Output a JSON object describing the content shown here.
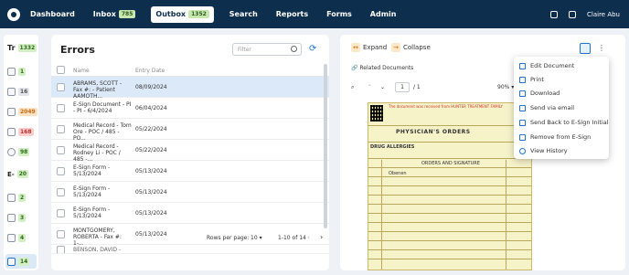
{
  "nav": {
    "items": [
      {
        "label": "Dashboard"
      },
      {
        "label": "Inbox",
        "badge": "785"
      },
      {
        "label": "Outbox",
        "badge": "1352",
        "active": true
      },
      {
        "label": "Search"
      },
      {
        "label": "Reports"
      },
      {
        "label": "Forms"
      },
      {
        "label": "Admin"
      }
    ],
    "user": "Claire Abu"
  },
  "sidebar": {
    "title": "Tr",
    "title_badge": "1332",
    "items": [
      {
        "badge": "1",
        "color": "green"
      },
      {
        "badge": "16",
        "color": "gray"
      },
      {
        "badge": "2049",
        "color": "orange"
      },
      {
        "badge": "168",
        "color": "red"
      },
      {
        "badge": "98",
        "color": "green"
      },
      {
        "label": "E-",
        "badge": "20",
        "color": "green"
      },
      {
        "badge": "2",
        "color": "green"
      },
      {
        "badge": "3",
        "color": "green"
      },
      {
        "badge": "4",
        "color": "green"
      },
      {
        "badge": "14",
        "color": "green"
      }
    ]
  },
  "errors": {
    "title": "Errors",
    "filter_placeholder": "Filter",
    "columns": [
      "Name",
      "Entry Date"
    ],
    "rows": [
      {
        "name": "ABRAMS, SCOTT - Fax #: - Patient AAMOTH...",
        "date": "08/09/2024",
        "selected": true
      },
      {
        "name": "E-Sign Document - PI - PI - 6/4/2024",
        "date": "06/04/2024"
      },
      {
        "name": "Medical Record - Tom Ore - POC / 485 - PO...",
        "date": "05/22/2024"
      },
      {
        "name": "Medical Record - Rodney Li - POC / 485 -...",
        "date": "05/22/2024"
      },
      {
        "name": "E-Sign Form - 5/13/2024",
        "date": "05/13/2024"
      },
      {
        "name": "E-Sign Form - 5/13/2024",
        "date": "05/13/2024"
      },
      {
        "name": "E-Sign Form - 5/13/2024",
        "date": "05/13/2024"
      },
      {
        "name": "MONTGOMERY, ROBERTA - Fax #: 1-...",
        "date": "05/13/2024"
      },
      {
        "name": "BENSON, DAVID - Fax #: ...",
        "date": ""
      }
    ],
    "footer": {
      "rows_per_page_label": "Rows per page:",
      "rows_per_page": "10",
      "range": "1-10 of 14"
    }
  },
  "viewer": {
    "expand_label": "Expand",
    "collapse_label": "Collapse",
    "related_docs": "Related Documents",
    "page": "1",
    "page_total": "/ 1",
    "zoom": "90%",
    "document": {
      "warning": "The document was received from HUNTER TREATMENT FAMILY",
      "title": "PHYSICIAN'S ORDERS",
      "drug_allergies": "DRUG ALLERGIES",
      "orders_header": "ORDERS AND SIGNATURE",
      "cell": "Obenen"
    }
  },
  "menu": {
    "items": [
      {
        "label": "Edit Document"
      },
      {
        "label": "Print"
      },
      {
        "label": "Download"
      },
      {
        "label": "Send via email"
      },
      {
        "label": "Send Back to E-Sign Initial"
      },
      {
        "label": "Remove from E-Sign"
      },
      {
        "label": "View History"
      }
    ]
  },
  "colors": {
    "nav_bg": "#0e2e4d",
    "accent": "#1f73c9",
    "selected_row": "#dce9f8"
  }
}
